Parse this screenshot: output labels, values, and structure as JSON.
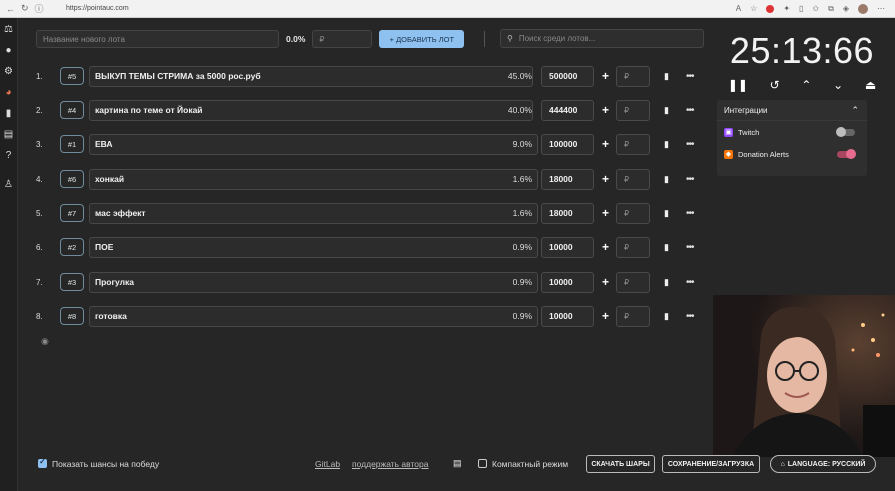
{
  "browser": {
    "url": "https://pointauc.com"
  },
  "top": {
    "new_lot_placeholder": "Название нового лота",
    "percent": "0.0%",
    "amount_placeholder": "₽",
    "add_button": "+ ДОБАВИТЬ ЛОТ",
    "search_placeholder": "Поиск среди лотов..."
  },
  "lots": [
    {
      "n": "1.",
      "tag": "#5",
      "name": "ВЫКУП ТЕМЫ СТРИМА за 5000 рос.руб",
      "pct": "45.0%",
      "amount": "500000",
      "rub": "₽"
    },
    {
      "n": "2.",
      "tag": "#4",
      "name": "картина по теме от Йокай",
      "pct": "40.0%",
      "amount": "444400",
      "rub": "₽"
    },
    {
      "n": "3.",
      "tag": "#1",
      "name": "ЕВА",
      "pct": "9.0%",
      "amount": "100000",
      "rub": "₽"
    },
    {
      "n": "4.",
      "tag": "#6",
      "name": "хонкай",
      "pct": "1.6%",
      "amount": "18000",
      "rub": "₽"
    },
    {
      "n": "5.",
      "tag": "#7",
      "name": "мас эффект",
      "pct": "1.6%",
      "amount": "18000",
      "rub": "₽"
    },
    {
      "n": "6.",
      "tag": "#2",
      "name": "ПОЕ",
      "pct": "0.9%",
      "amount": "10000",
      "rub": "₽"
    },
    {
      "n": "7.",
      "tag": "#3",
      "name": "Прогулка",
      "pct": "0.9%",
      "amount": "10000",
      "rub": "₽"
    },
    {
      "n": "8.",
      "tag": "#8",
      "name": "готовка",
      "pct": "0.9%",
      "amount": "10000",
      "rub": "₽"
    }
  ],
  "timer": {
    "value": "25:13:66"
  },
  "integrations": {
    "title": "Интеграции",
    "items": [
      {
        "name": "Twitch",
        "enabled": false,
        "color": "#9146ff"
      },
      {
        "name": "Donation Alerts",
        "enabled": true,
        "color": "#f57507"
      }
    ]
  },
  "bottom": {
    "show_chances": "Показать шансы на победу",
    "gitlab": "GitLab",
    "support": "поддержать автора",
    "compact": "Компактный режим",
    "download": "СКАЧАТЬ ШАРЫ",
    "save": "СОХРАНЕНИЕ/ЗАГРУЗКА",
    "language": "LANGUAGE: РУССКИЙ"
  },
  "colors": {
    "accent": "#8fc1f0",
    "toggle_on": "#e76b8e",
    "bg": "#262626"
  }
}
